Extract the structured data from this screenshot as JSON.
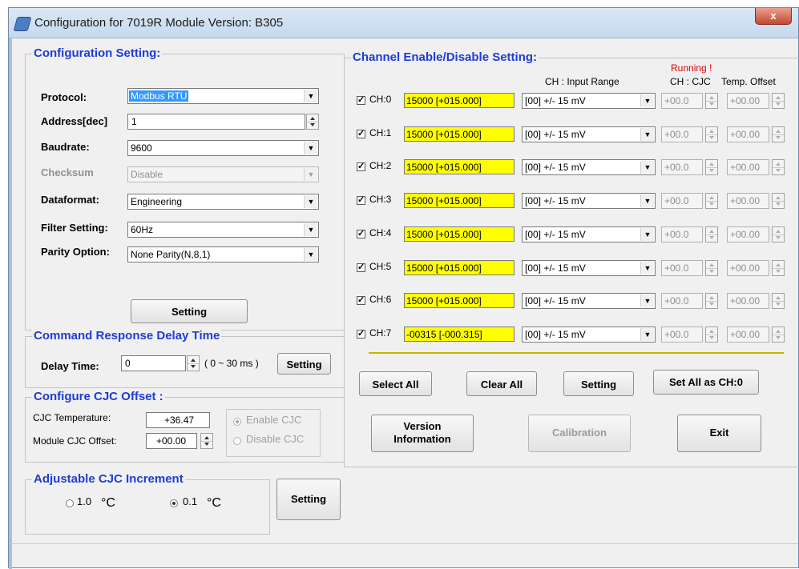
{
  "window": {
    "title": "Configuration for 7019R Module Version: B305",
    "close_glyph": "x"
  },
  "config": {
    "title": "Configuration Setting:",
    "protocol_label": "Protocol:",
    "protocol_value": "Modbus RTU",
    "address_label": "Address[dec]",
    "address_value": "1",
    "baudrate_label": "Baudrate:",
    "baudrate_value": "9600",
    "checksum_label": "Checksum",
    "checksum_value": "Disable",
    "dataformat_label": "Dataformat:",
    "dataformat_value": "Engineering",
    "filter_label": "Filter Setting:",
    "filter_value": "60Hz",
    "parity_label": "Parity Option:",
    "parity_value": "None Parity(N,8,1)",
    "setting_button": "Setting"
  },
  "delay": {
    "title": "Command Response Delay Time",
    "label": "Delay Time:",
    "value": "0",
    "range": "( 0 ~ 30 ms )",
    "setting_button": "Setting"
  },
  "cjc": {
    "title": "Configure CJC Offset :",
    "temp_label": "CJC Temperature:",
    "temp_value": "+36.47",
    "offset_label": "Module CJC Offset:",
    "offset_value": "+00.00",
    "enable_label": "Enable CJC",
    "disable_label": "Disable CJC"
  },
  "increment": {
    "title": "Adjustable CJC Increment",
    "opt1": "1.0",
    "opt2": "0.1",
    "unit": "°C",
    "setting_button": "Setting"
  },
  "channels": {
    "title": "Channel Enable/Disable Setting:",
    "running": "Running !",
    "hdr_range": "CH : Input Range",
    "hdr_cjc": "CH : CJC",
    "hdr_offset": "Temp. Offset",
    "check_glyph": "✓",
    "arrow_glyph": "▼",
    "list": [
      {
        "name": "CH:0",
        "value": "15000  [+015.000]",
        "range": "[00] +/- 15 mV",
        "cjc": "+00.0",
        "offset": "+00.00"
      },
      {
        "name": "CH:1",
        "value": "15000  [+015.000]",
        "range": "[00] +/- 15 mV",
        "cjc": "+00.0",
        "offset": "+00.00"
      },
      {
        "name": "CH:2",
        "value": "15000  [+015.000]",
        "range": "[00] +/- 15 mV",
        "cjc": "+00.0",
        "offset": "+00.00"
      },
      {
        "name": "CH:3",
        "value": "15000  [+015.000]",
        "range": "[00] +/- 15 mV",
        "cjc": "+00.0",
        "offset": "+00.00"
      },
      {
        "name": "CH:4",
        "value": "15000  [+015.000]",
        "range": "[00] +/- 15 mV",
        "cjc": "+00.0",
        "offset": "+00.00"
      },
      {
        "name": "CH:5",
        "value": "15000  [+015.000]",
        "range": "[00] +/- 15 mV",
        "cjc": "+00.0",
        "offset": "+00.00"
      },
      {
        "name": "CH:6",
        "value": "15000  [+015.000]",
        "range": "[00] +/- 15 mV",
        "cjc": "+00.0",
        "offset": "+00.00"
      },
      {
        "name": "CH:7",
        "value": "-00315  [-000.315]",
        "range": "[00] +/- 15 mV",
        "cjc": "+00.0",
        "offset": "+00.00"
      }
    ],
    "select_all": "Select All",
    "clear_all": "Clear All",
    "setting": "Setting",
    "set_all": "Set All as CH:0",
    "version": "Version Information",
    "calibration": "Calibration",
    "exit": "Exit"
  }
}
